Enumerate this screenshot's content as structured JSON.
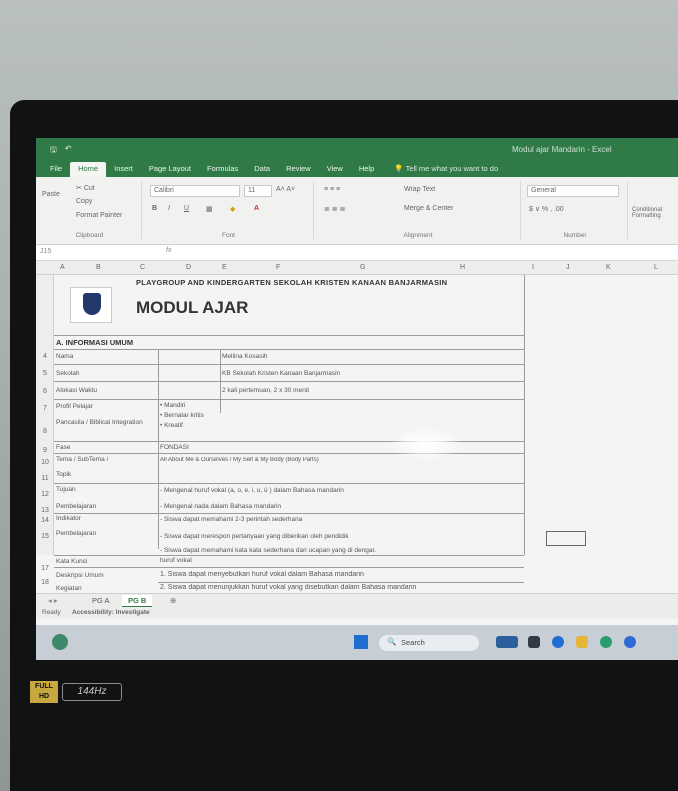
{
  "app": {
    "title": "Modul ajar Mandarin - Excel"
  },
  "menu": {
    "tabs": [
      "File",
      "Home",
      "Insert",
      "Page Layout",
      "Formulas",
      "Data",
      "Review",
      "View",
      "Help"
    ],
    "active": "Home",
    "tell_me": "Tell me what you want to do"
  },
  "ribbon": {
    "clipboard": {
      "paste": "Paste",
      "cut": "Cut",
      "copy": "Copy",
      "format_painter": "Format Painter",
      "label": "Clipboard"
    },
    "font": {
      "name": "Calibri",
      "size": "11",
      "label": "Font"
    },
    "alignment": {
      "wrap": "Wrap Text",
      "merge": "Merge & Center",
      "label": "Alignment"
    },
    "number": {
      "format": "General",
      "label": "Number"
    },
    "styles": {
      "conditional": "Conditional Formatting"
    }
  },
  "formula_bar": {
    "cell_ref": "J15",
    "fx": "fx"
  },
  "columns": [
    "A",
    "B",
    "C",
    "D",
    "E",
    "F",
    "G",
    "H",
    "I",
    "J",
    "K",
    "L"
  ],
  "sheet": {
    "heading": "PLAYGROUP AND KINDERGARTEN SEKOLAH KRISTEN KANAAN BANJARMASIN",
    "title": "MODUL AJAR",
    "section": "A. INFORMASI UMUM",
    "rows": [
      {
        "num": "4",
        "label": "Nama",
        "value": "Mellina Kosasih"
      },
      {
        "num": "5",
        "label": "Sekolah",
        "value": "KB Sekolah Kristen Kanaan Banjarmasin"
      },
      {
        "num": "6",
        "label": "Alokasi Waktu",
        "value": "2 kali pertemuan, 2 x 30 menit"
      },
      {
        "num": "7",
        "label": "Profil Pelajar",
        "value": "• Mandiri"
      },
      {
        "num": "8",
        "label": "Pancasila / Biblical Integration",
        "value": "• Bernalar kritis"
      },
      {
        "num": "8b",
        "label": "",
        "value": "• Kreatif"
      },
      {
        "num": "9",
        "label": "Fase",
        "value": "FONDASI"
      },
      {
        "num": "10",
        "label": "Tema / SubTema /",
        "value": "All About Me & Ourselves / My Self & My Body (Body Parts)"
      },
      {
        "num": "11",
        "label": "Topik",
        "value": ""
      },
      {
        "num": "12",
        "label": "Tujuan",
        "value": "- Mengenal huruf vokal (a, o, e, i, u, ü ) dalam Bahasa mandarin"
      },
      {
        "num": "13",
        "label": "Pembelajaran",
        "value": "- Mengenal nada dalam Bahasa mandarin"
      },
      {
        "num": "14",
        "label": "Indikator",
        "value": "- Siswa dapat memahami 2-3 perintah sederhana"
      },
      {
        "num": "15",
        "label": "Pembelajaran",
        "value": "- Siswa dapat merespon pertanyaan yang diberikan oleh pendidik"
      },
      {
        "num": "16",
        "label": "",
        "value": "- Siswa dapat memahami kata kata sederhana dari ucapan yang di dengar."
      },
      {
        "num": "17",
        "label": "Kata Kunci",
        "value": "huruf vokal"
      },
      {
        "num": "18",
        "label": "Deskripsi Umum",
        "value": "1. Siswa dapat menyebutkan huruf vokal dalam Bahasa mandarin"
      },
      {
        "num": "19",
        "label": "Kegiatan",
        "value": "2. Siswa dapat menunjukkan huruf vokal yang disebutkan dalam Bahasa mandarin"
      }
    ]
  },
  "sheet_tabs": [
    "PG A",
    "PG B"
  ],
  "active_sheet": "PG B",
  "status": {
    "ready": "Ready",
    "accessibility": "Accessibility: Investigate"
  },
  "taskbar": {
    "search": "Search"
  },
  "sticker": {
    "fullhd": "FULL HD",
    "hz": "144Hz"
  }
}
